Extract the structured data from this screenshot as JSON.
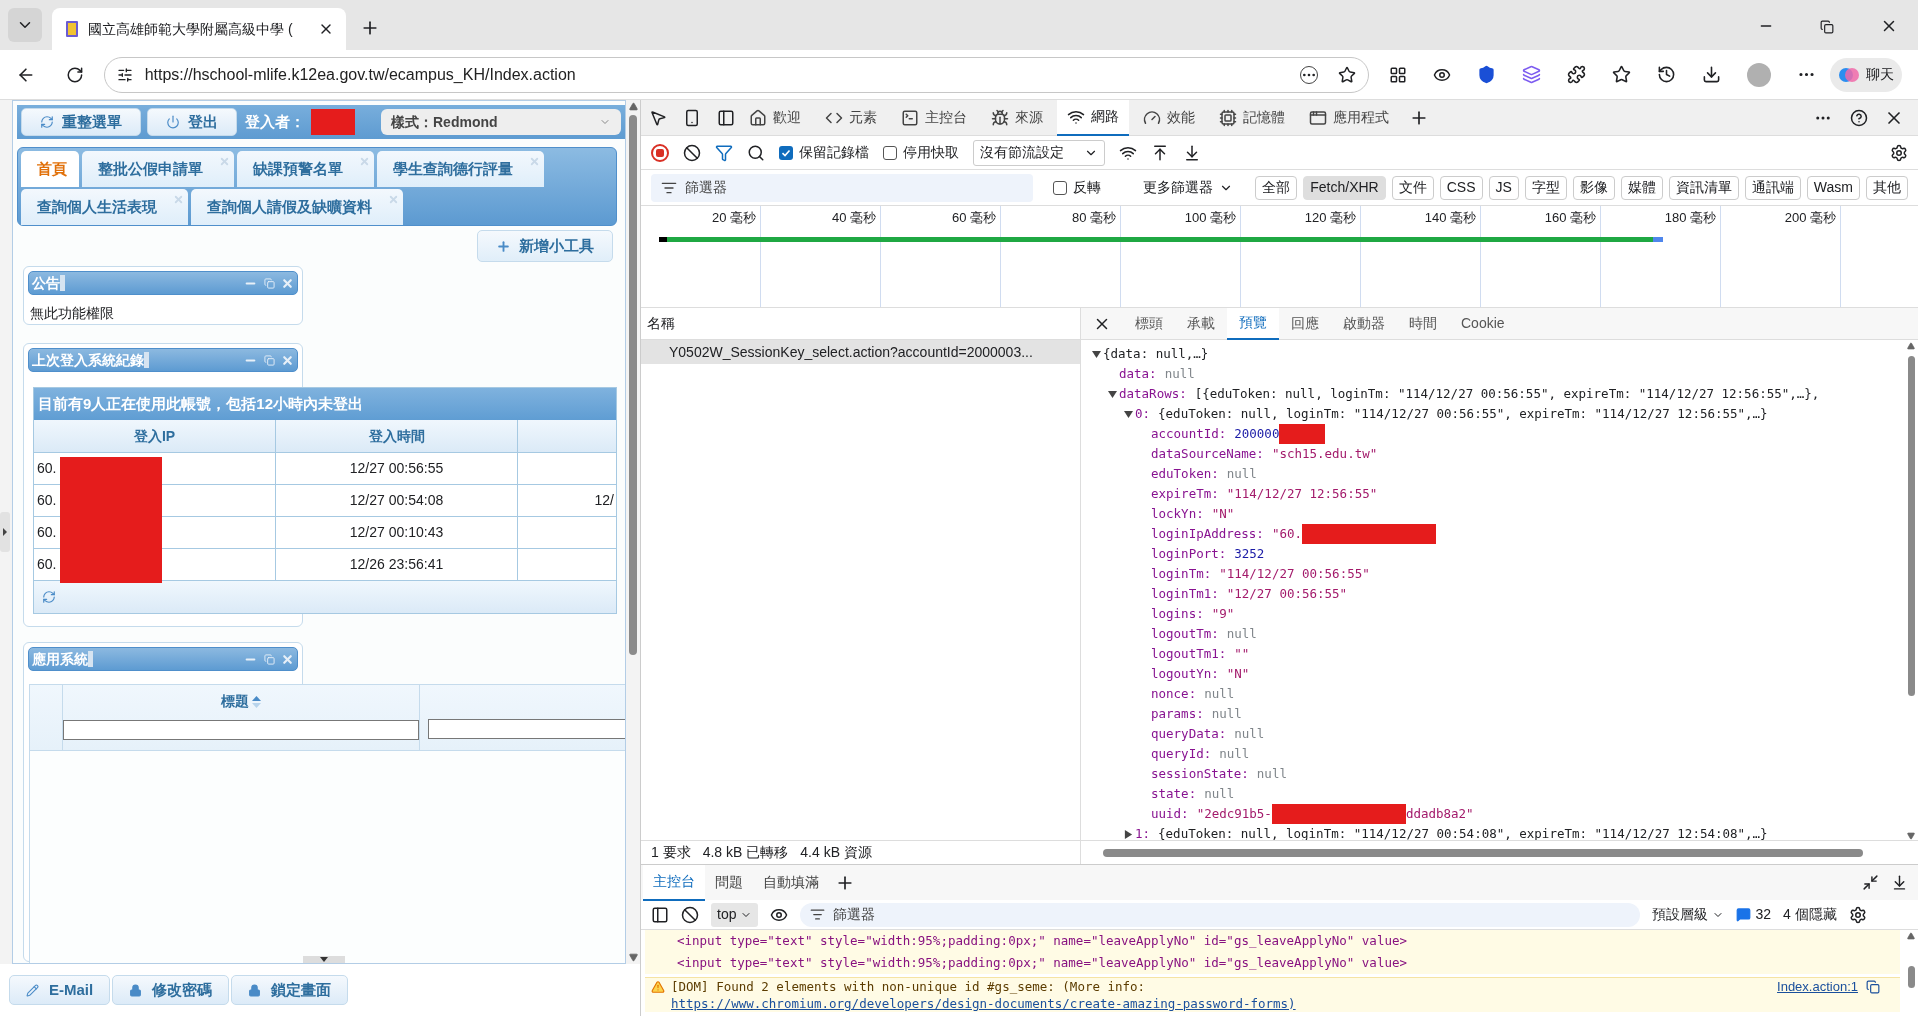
{
  "browser": {
    "tab_title": "國立高雄師範大學附屬高級中學 (",
    "url": "https://hschool-mlife.k12ea.gov.tw/ecampus_KH/Index.action",
    "chat_label": "聊天"
  },
  "page": {
    "top_buttons": [
      {
        "kind": "refresh",
        "label": "重整選單"
      },
      {
        "kind": "power",
        "label": "登出"
      }
    ],
    "user_label": "登入者：",
    "user_redacted": true,
    "style_select": "樣式：Redmond",
    "tabs": [
      {
        "label": "首頁",
        "selected": true,
        "closable": false
      },
      {
        "label": "整批公假申請單",
        "selected": false,
        "closable": true
      },
      {
        "label": "缺課預警名單",
        "selected": false,
        "closable": true
      },
      {
        "label": "學生查詢德行評量",
        "selected": false,
        "closable": true
      },
      {
        "label": "查詢個人生活表現",
        "selected": false,
        "closable": true
      },
      {
        "label": "查詢個人請假及缺曠資料",
        "selected": false,
        "closable": true
      }
    ],
    "add_widget": "新增小工具",
    "announcement": {
      "title": "公告",
      "body": "無此功能權限"
    },
    "login_records": {
      "title": "上次登入系統紀錄",
      "banner": "目前有9人正在使用此帳號，包括12小時內未登出",
      "columns": [
        "登入IP",
        "登入時間"
      ],
      "ip_redacted": true,
      "rows": [
        {
          "ip": "60.",
          "time": "12/27 00:56:55"
        },
        {
          "ip": "60.",
          "time": "12/27 00:54:08",
          "column_3": "12/"
        },
        {
          "ip": "60.",
          "time": "12/27 00:10:43"
        },
        {
          "ip": "60.",
          "time": "12/26 23:56:41"
        }
      ]
    },
    "apps": {
      "title": "應用系統",
      "column": "標題"
    },
    "bottom_buttons": [
      {
        "kind": "pencil",
        "label": "E-Mail"
      },
      {
        "kind": "lock",
        "label": "修改密碼"
      },
      {
        "kind": "lock",
        "label": "鎖定畫面"
      }
    ]
  },
  "devtools": {
    "tabs": [
      {
        "kind": "home",
        "label": "歡迎",
        "selected": false
      },
      {
        "kind": "code",
        "label": "元素",
        "selected": false
      },
      {
        "kind": "console",
        "label": "主控台",
        "selected": false
      },
      {
        "kind": "bug",
        "label": "來源",
        "selected": false
      },
      {
        "kind": "wifi",
        "label": "網路",
        "selected": true
      },
      {
        "kind": "gauge",
        "label": "效能",
        "selected": false
      },
      {
        "kind": "chip",
        "label": "記憶體",
        "selected": false
      },
      {
        "kind": "window",
        "label": "應用程式",
        "selected": false
      }
    ],
    "preserve_log": {
      "label": "保留記錄檔",
      "checked": true
    },
    "disable_cache": {
      "label": "停用快取",
      "checked": false
    },
    "throttle": "沒有節流設定",
    "filter": {
      "placeholder": "篩選器",
      "invert": {
        "label": "反轉",
        "checked": false
      },
      "more_filters": "更多篩選器",
      "types": [
        {
          "label": "全部",
          "selected": false
        },
        {
          "label": "Fetch/XHR",
          "selected": true
        },
        {
          "label": "文件",
          "selected": false
        },
        {
          "label": "CSS",
          "selected": false
        },
        {
          "label": "JS",
          "selected": false
        },
        {
          "label": "字型",
          "selected": false
        },
        {
          "label": "影像",
          "selected": false
        },
        {
          "label": "媒體",
          "selected": false
        },
        {
          "label": "資訊清單",
          "selected": false
        },
        {
          "label": "通訊端",
          "selected": false
        },
        {
          "label": "Wasm",
          "selected": false
        },
        {
          "label": "其他",
          "selected": false
        }
      ]
    },
    "timeline_ticks": [
      "20 毫秒",
      "40 毫秒",
      "60 毫秒",
      "80 毫秒",
      "100 毫秒",
      "120 毫秒",
      "140 毫秒",
      "160 毫秒",
      "180 毫秒",
      "200 毫秒"
    ],
    "requests": {
      "column": "名稱",
      "rows": [
        {
          "name": "Y0502W_SessionKey_select.action?accountId=2000003...",
          "selected": true
        }
      ]
    },
    "detail_tabs": [
      {
        "label": "標頭",
        "selected": false
      },
      {
        "label": "承載",
        "selected": false
      },
      {
        "label": "預覽",
        "selected": true
      },
      {
        "label": "回應",
        "selected": false
      },
      {
        "label": "啟動器",
        "selected": false
      },
      {
        "label": "時間",
        "selected": false
      },
      {
        "label": "Cookie",
        "selected": false
      }
    ],
    "preview": {
      "kind": "object",
      "value": "{data: null,…}",
      "expanded": true,
      "children": [
        {
          "key": "data:",
          "kind": "null",
          "value": "null"
        },
        {
          "key": "dataRows:",
          "kind": "object",
          "value": "[{eduToken: null, loginTm: \"114/12/27 00:56:55\", expireTm: \"114/12/27 12:56:55\",…},",
          "expanded": true,
          "children": [
            {
              "key": "0:",
              "kind": "object",
              "value": "{eduToken: null, loginTm: \"114/12/27 00:56:55\", expireTm: \"114/12/27 12:56:55\",…}",
              "expanded": true,
              "children": [
                {
                  "key": "accountId:",
                  "kind": "number",
                  "value": "200000",
                  "redacted": true
                },
                {
                  "key": "dataSourceName:",
                  "kind": "string",
                  "value": "\"sch15.edu.tw\""
                },
                {
                  "key": "eduToken:",
                  "kind": "null",
                  "value": "null"
                },
                {
                  "key": "expireTm:",
                  "kind": "string",
                  "value": "\"114/12/27 12:56:55\""
                },
                {
                  "key": "lockYn:",
                  "kind": "string",
                  "value": "\"N\""
                },
                {
                  "key": "loginIpAddress:",
                  "kind": "string",
                  "value": "\"60.",
                  "redacted": true
                },
                {
                  "key": "loginPort:",
                  "kind": "number",
                  "value": "3252"
                },
                {
                  "key": "loginTm:",
                  "kind": "string",
                  "value": "\"114/12/27 00:56:55\""
                },
                {
                  "key": "loginTm1:",
                  "kind": "string",
                  "value": "\"12/27 00:56:55\""
                },
                {
                  "key": "logins:",
                  "kind": "string",
                  "value": "\"9\""
                },
                {
                  "key": "logoutTm:",
                  "kind": "null",
                  "value": "null"
                },
                {
                  "key": "logoutTm1:",
                  "kind": "string",
                  "value": "\"\""
                },
                {
                  "key": "logoutYn:",
                  "kind": "string",
                  "value": "\"N\""
                },
                {
                  "key": "nonce:",
                  "kind": "null",
                  "value": "null"
                },
                {
                  "key": "params:",
                  "kind": "null",
                  "value": "null"
                },
                {
                  "key": "queryData:",
                  "kind": "null",
                  "value": "null"
                },
                {
                  "key": "queryId:",
                  "kind": "null",
                  "value": "null"
                },
                {
                  "key": "sessionState:",
                  "kind": "null",
                  "value": "null"
                },
                {
                  "key": "state:",
                  "kind": "null",
                  "value": "null"
                },
                {
                  "key": "uuid:",
                  "kind": "string",
                  "value": "\"2edc91b5-",
                  "redacted": true,
                  "value_tail": "ddadb8a2\""
                }
              ]
            },
            {
              "key": "1:",
              "kind": "object",
              "value": "{eduToken: null, loginTm: \"114/12/27 00:54:08\", expireTm: \"114/12/27 12:54:08\",…}",
              "expanded": false
            }
          ]
        }
      ]
    },
    "status": [
      "1 要求",
      "4.8 kB 已轉移",
      "4.4 kB 資源"
    ],
    "console": {
      "tabs": [
        {
          "label": "主控台",
          "selected": true
        },
        {
          "label": "問題",
          "selected": false
        },
        {
          "label": "自動填滿",
          "selected": false
        }
      ],
      "context": "top",
      "filter_placeholder": "篩選器",
      "levels": "預設層級",
      "message_count": "32",
      "hidden": "4 個隱藏",
      "messages": [
        {
          "kind": "code",
          "text": "<input type=\"text\" style=\"width:95%;padding:0px;\" name=\"leaveApplyNo\" id=\"gs_leaveApplyNo\" value>"
        },
        {
          "kind": "code",
          "text": "<input type=\"text\" style=\"width:95%;padding:0px;\" name=\"leaveApplyNo\" id=\"gs_leaveApplyNo\" value>"
        },
        {
          "kind": "warning",
          "text": "[DOM] Found 2 elements with non-unique id #gs_seme: (More info:",
          "link": "https://www.chromium.org/developers/design-documents/create-amazing-password-forms)",
          "source": "Index.action:1"
        }
      ]
    }
  }
}
